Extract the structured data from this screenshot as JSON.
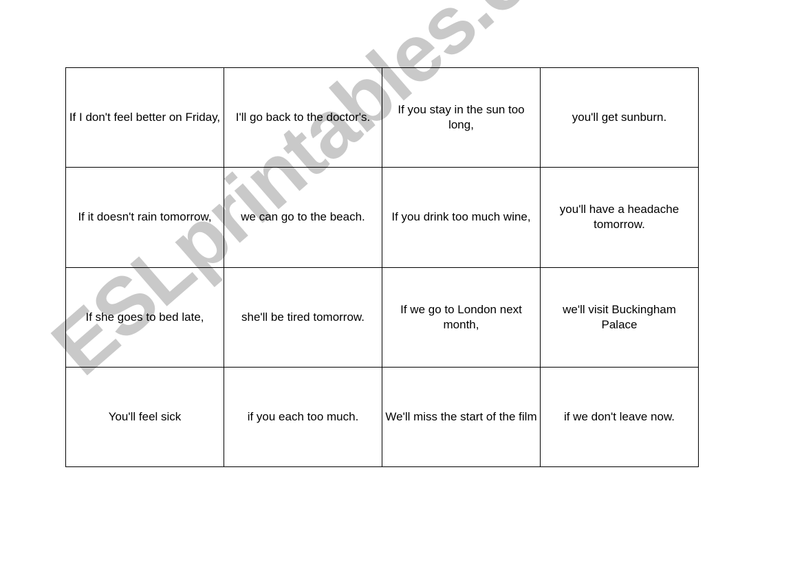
{
  "watermark": "ESLprintables.com",
  "cards": [
    [
      "If I don't feel better on Friday,",
      "I'll go back to the doctor's.",
      "If you stay in the sun too long,",
      "you'll get sunburn."
    ],
    [
      "If it doesn't rain tomorrow,",
      "we can go to the beach.",
      "If you drink too much wine,",
      "you'll have a headache tomorrow."
    ],
    [
      "If she goes to bed late,",
      "she'll be tired tomorrow.",
      "If we go to London next month,",
      "we'll visit Buckingham Palace"
    ],
    [
      "You'll feel sick",
      "if you each too much.",
      "We'll miss the start of the film",
      "if we don't leave now."
    ]
  ]
}
